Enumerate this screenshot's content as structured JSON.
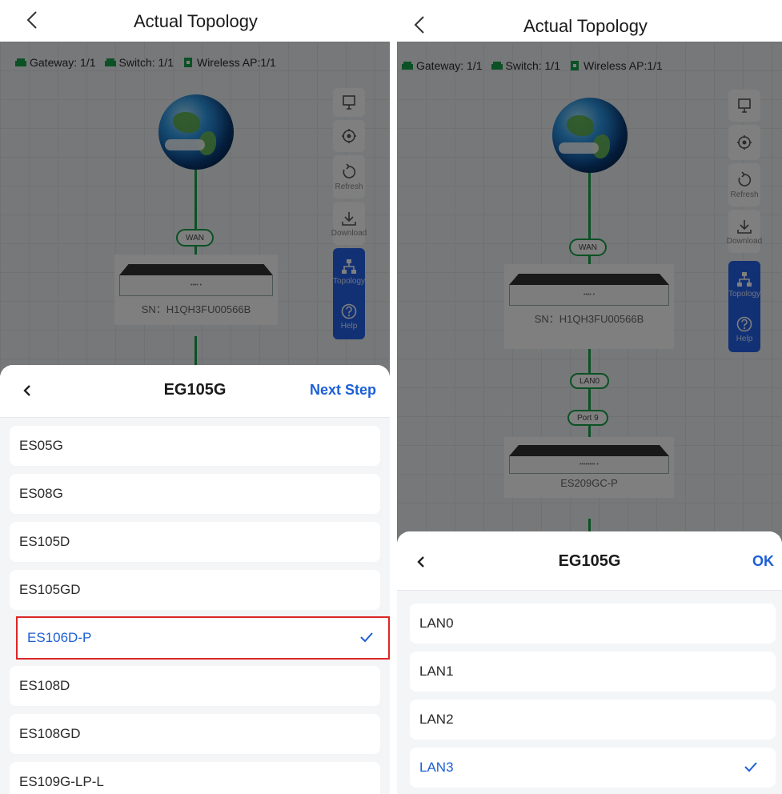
{
  "screens": [
    {
      "title": "Actual Topology",
      "stats": {
        "gateway": "Gateway: 1/1",
        "switch": "Switch: 1/1",
        "wireless_ap": "Wireless AP:1/1"
      },
      "links": [
        "WAN"
      ],
      "devices": [
        {
          "body_text": "•••• •",
          "label": "SN：H1QH3FU00566B"
        }
      ],
      "toolbar": {
        "refresh_label": "Refresh",
        "download_label": "Download",
        "topology_label": "Topology",
        "help_label": "Help"
      },
      "sheet": {
        "title": "EG105G",
        "action_label": "Next Step",
        "items": [
          {
            "label": "ES05G",
            "selected": false
          },
          {
            "label": "ES08G",
            "selected": false
          },
          {
            "label": "ES105D",
            "selected": false
          },
          {
            "label": "ES105GD",
            "selected": false
          },
          {
            "label": "ES106D-P",
            "selected": true
          },
          {
            "label": "ES108D",
            "selected": false
          },
          {
            "label": "ES108GD",
            "selected": false
          },
          {
            "label": "ES109G-LP-L",
            "selected": false
          }
        ]
      }
    },
    {
      "title": "Actual Topology",
      "stats": {
        "gateway": "Gateway: 1/1",
        "switch": "Switch: 1/1",
        "wireless_ap": "Wireless AP:1/1"
      },
      "links": [
        "WAN",
        "LAN0",
        "Port 9"
      ],
      "devices": [
        {
          "body_text": "•••• •",
          "label": "SN：H1QH3FU00566B"
        },
        {
          "body_text": "•••••••• •",
          "label": "ES209GC-P"
        }
      ],
      "toolbar": {
        "refresh_label": "Refresh",
        "download_label": "Download",
        "topology_label": "Topology",
        "help_label": "Help"
      },
      "sheet": {
        "title": "EG105G",
        "action_label": "OK",
        "items": [
          {
            "label": "LAN0",
            "selected": false
          },
          {
            "label": "LAN1",
            "selected": false
          },
          {
            "label": "LAN2",
            "selected": false
          },
          {
            "label": "LAN3",
            "selected": true
          }
        ]
      }
    }
  ],
  "colors": {
    "accent": "#1d5fd6",
    "link_green": "#16a34a",
    "highlight_red": "#dc2626",
    "toolbar_blue": "#2563eb"
  }
}
